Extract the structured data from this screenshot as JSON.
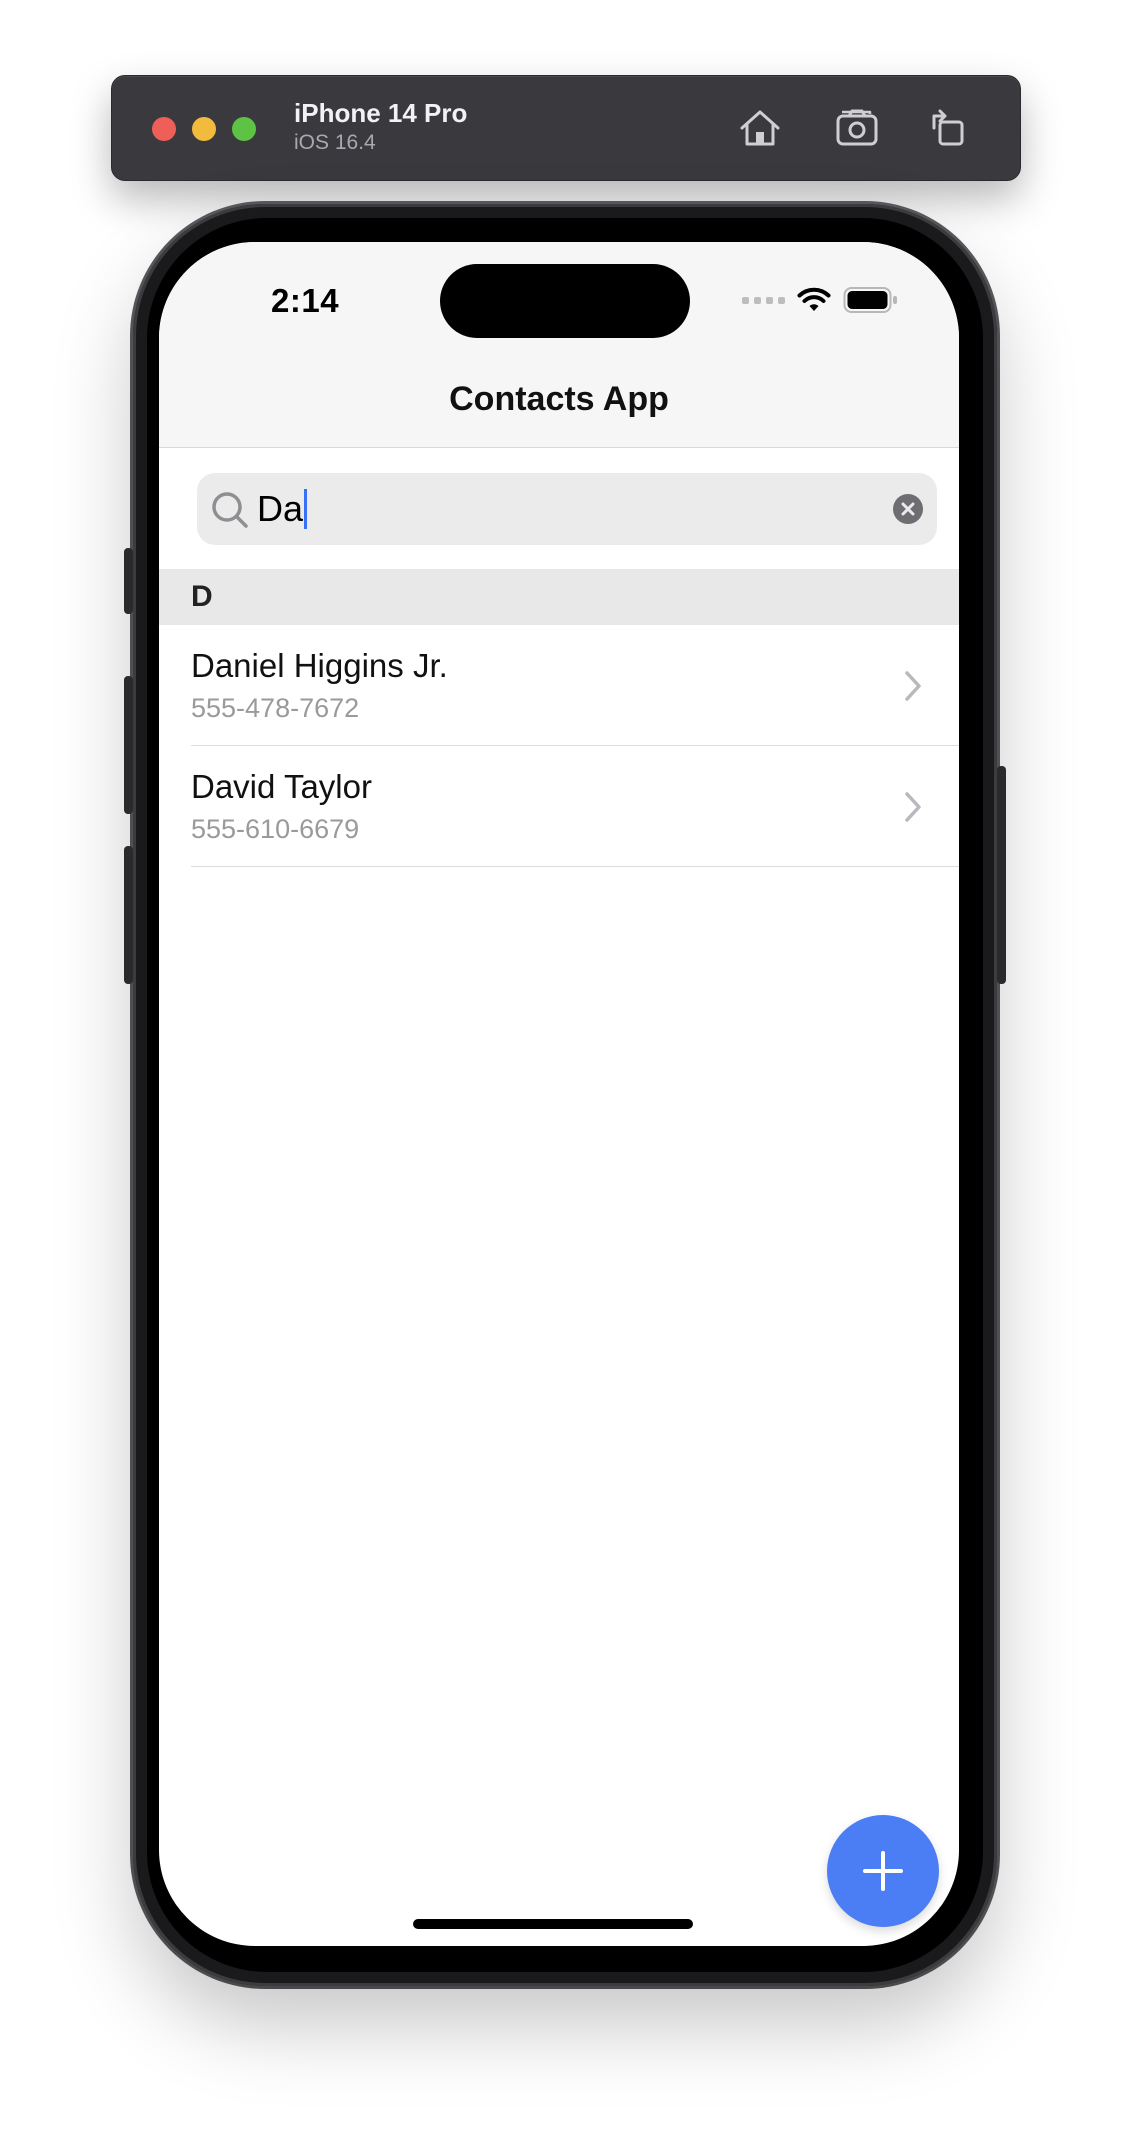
{
  "simulator": {
    "device_name": "iPhone 14 Pro",
    "os_version": "iOS 16.4",
    "buttons": [
      "home-icon",
      "screenshot-icon",
      "rotate-icon"
    ]
  },
  "status_bar": {
    "time": "2:14"
  },
  "navigation": {
    "title": "Contacts App"
  },
  "search": {
    "value": "Da",
    "has_clear_button": true
  },
  "contacts": {
    "sections": [
      {
        "letter": "D",
        "items": [
          {
            "name": "Daniel Higgins Jr.",
            "phone": "555-478-7672"
          },
          {
            "name": "David Taylor",
            "phone": "555-610-6679"
          }
        ]
      }
    ]
  },
  "colors": {
    "accent": "#4b7ef5",
    "caret": "#3a6ff7",
    "sim_bar": "#3a393e"
  }
}
